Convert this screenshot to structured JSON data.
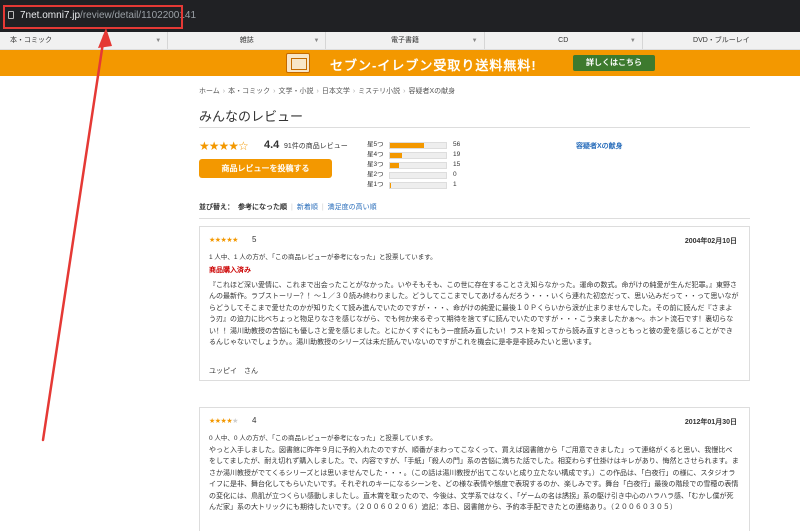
{
  "address_bar": {
    "host": "7net.omni7.jp",
    "path": "/review/detail/1102200141"
  },
  "category_nav": [
    {
      "label": "本・コミック"
    },
    {
      "label": "雑誌"
    },
    {
      "label": "電子書籍"
    },
    {
      "label": "CD"
    },
    {
      "label": "DVD・ブルーレイ"
    }
  ],
  "banner": {
    "text": "セブン-イレブン受取り送料無料!",
    "button": "詳しくはこちら",
    "icon": "store-icon",
    "color": "#f39800"
  },
  "breadcrumb": [
    "ホーム",
    "本・コミック",
    "文学・小説",
    "日本文学",
    "ミステリ小説",
    "容疑者Xの献身"
  ],
  "page_title": "みんなのレビュー",
  "summary": {
    "stars": "★★★★☆",
    "score": "4.4",
    "count_text": "91件の商品レビュー",
    "write_button": "商品レビューを投稿する",
    "book_link": "容疑者Xの献身",
    "distribution": [
      {
        "label": "星5つ",
        "count": "56",
        "fraction": 0.615
      },
      {
        "label": "星4つ",
        "count": "19",
        "fraction": 0.209
      },
      {
        "label": "星3つ",
        "count": "15",
        "fraction": 0.165
      },
      {
        "label": "星2つ",
        "count": "0",
        "fraction": 0.0
      },
      {
        "label": "星1つ",
        "count": "1",
        "fraction": 0.011
      }
    ]
  },
  "sort": {
    "label": "並び替え：",
    "options": [
      {
        "label": "参考になった順"
      },
      {
        "label": "新着順"
      },
      {
        "label": "満足度の高い順"
      }
    ]
  },
  "reviews": [
    {
      "stars_on": "★★★★★",
      "stars_off": "",
      "score": "5",
      "date": "2004年02月10日",
      "helpful": "1 人中、1 人の方が、「この商品レビューが参考になった」と投票しています。",
      "badge": "商品購入済み",
      "body": "『これほど深い愛情に、これまで出会ったことがなかった。いやそもそも、この世に存在することさえ知らなかった。運命の数式。命がけの純愛が生んだ犯罪。』東野さんの最新作。ラブストーリー？！～１／３０読み終わりました。どうしてここまでしてあげるんだろう・・・いくら連れた初恋だって、思い込みだって・・って思いながらどうしてそこまで愛せたのかが知りたくて読み進んでいたのですが・・・、命がけの純愛に最後１０Ｐくらいから涙が止まりませんでした。その前に読んだ『さまよう刃』の迫力に比べちょっと物足りなさを感じながら、でも何か来るぞって期待を捨てずに読んでいたのですが・・・こう来ましたかぁ～。ホント流石です！裏切らない！！湯川助教授の苦悩にも優しさと愛を感じました。とにかくすぐにもう一度読み直したい！ラストを知ってから読み直すときっともっと彼の愛を感じることができるんじゃないでしょうか。。湯川助教授のシリーズは未だ読んでいないのですがこれを機会に是非是非読みたいと思います。",
      "author": "ユッピイ　さん"
    },
    {
      "stars_on": "★★★★",
      "stars_off": "★",
      "score": "4",
      "date": "2012年01月30日",
      "helpful": "0 人中、0 人の方が、「この商品レビューが参考になった」と投票しています。",
      "badge": "",
      "body": "やっと入手しました。図書館に昨年９月に予約入れたのですが、順番がまわってこなくって、買えば図書館から「ご用意できました」って連絡がくると思い、我慢比べをしてましたが、耐え切れず購入しました。で、内容ですが、「手紙」「殺人の門」系の苦悩に満ちた話でした。相変わらず仕掛けはキレがあり、悔然とさせられます。まさか湯川教授がでてくるシリーズとは思いませんでした・・・。（この話は湯川教授が出てこないと成り立たない構成です。）この作品は、「白夜行」の様に、スタジオライフに是非、舞台化してもらいたいです。それぞれのキーになるシーンを、どの様な表情や態度で表現するのか、楽しみです。舞台「白夜行」最後の階段での雪穂の表情の変化には、鳥肌が立つくらい感動しましたし。直木賞を取ったので、今後は、文学系ではなく、「ゲームの名は誘拐」系の駆け引き中心のハラハラ感、「むかし僕が死んだ家」系の大トリックにも期待したいです。（２００６０２０６）追記：本日、図書館から、予約本手配できたとの連絡あり。（２００６０３０５）",
      "author": ""
    }
  ],
  "colors": {
    "accent": "#f39800",
    "link": "#2a6ebb",
    "annotation": "#e53935",
    "badge": "#cc0000"
  }
}
